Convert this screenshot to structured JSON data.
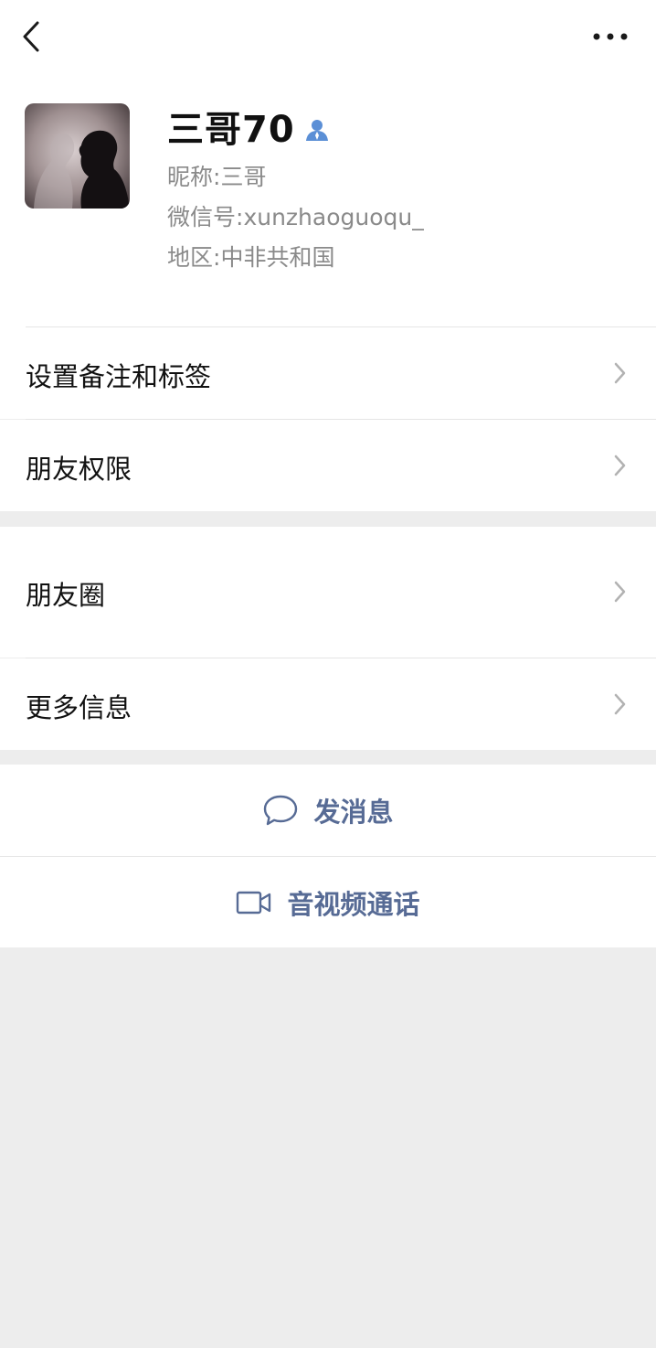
{
  "topbar": {
    "back_icon": "chevron-left-icon",
    "more_icon": "more-horizontal-icon"
  },
  "profile": {
    "name": "三哥70",
    "contact_icon": "person-contact-icon",
    "nickname_label": "昵称:",
    "nickname": "三哥",
    "wechat_id_label": "微信号:",
    "wechat_id": "xunzhaoguoqu_",
    "region_label": "地区:",
    "region": "中非共和国"
  },
  "menu": {
    "remarks_tags": "设置备注和标签",
    "friend_permissions": "朋友权限",
    "moments": "朋友圈",
    "more_info": "更多信息"
  },
  "actions": {
    "send_message": "发消息",
    "video_call": "音视频通话"
  },
  "colors": {
    "accent": "#576b95",
    "contact_icon": "#5b8fd6",
    "background": "#ededed"
  }
}
